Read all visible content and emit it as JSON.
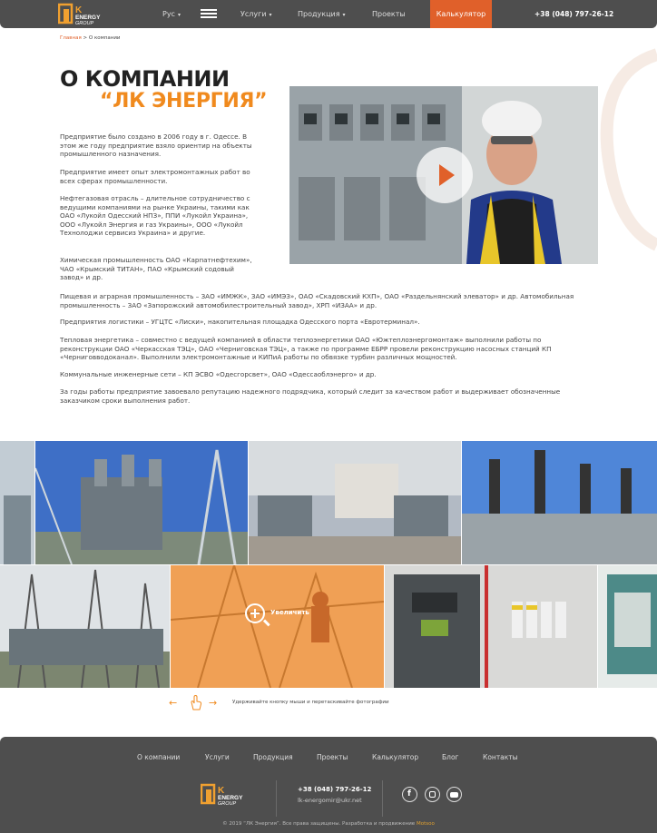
{
  "header": {
    "logo_text": "ЛК ENERGY GROUP",
    "lang": "Рус",
    "nav": [
      "Услуги",
      "Продукция",
      "Проекты"
    ],
    "calc": "Калькулятор",
    "phone": "+38 (048) 797-26-12"
  },
  "breadcrumb": {
    "home": "Главная",
    "sep": ">",
    "current": "О компании"
  },
  "title": {
    "line1": "О КОМПАНИИ",
    "line2": "“ЛК ЭНЕРГИЯ”"
  },
  "paragraphs": [
    "Предприятие было создано в 2006 году в г. Одессе. В этом же году предприятие взяло ориентир на объекты промышленного назначения.",
    "Предприятие имеет опыт электромонтажных работ во всех сферах промышленности.",
    "Нефтегазовая отрасль – длительное сотрудничество с ведущими компаниями на рынке Украины, такими как ОАО «Лукойл Одесский НПЗ», ППИ «Лукойл Украина», ООО «Лукойл Энергия и газ Украины», ООО «Лукойл Технолоджи сервисиз Украина» и другие.",
    "Химическая промышленность ОАО «Карпатнефтехим», ЧАО «Крымский ТИТАН», ПАО «Крымский содовый завод» и др.",
    "Пищевая и аграрная промышленность – ЗАО «ИМЖК», ЗАО «ИМЭЗ», ОАО «Скадовский КХП», ОАО «Раздельнянский элеватор» и др. Автомобильная промышленность – ЗАО «Запорожский автомобилестроительный завод», ХРП «ИЗАА» и др.",
    "Предприятия логистики – УГЦТС «Лиски», накопительная площадка Одесского порта «Евротерминал».",
    "Тепловая энергетика – совместно с ведущей компанией в области теплоэнергетики ОАО «Южтеплоэнергомонтаж» выполнили работы по реконструкции ОАО «Черкасская ТЭЦ», ОАО «Черниговская ТЭЦ», а также по программе ЕБРР провели реконструкцию насосных станций КП «Черниговводоканал». Выполнили электромонтажные и КИПиА работы по обвязке турбин различных мощностей.",
    "Коммунальные инженерные сети – КП ЭСВО «Одесгорсвет», ОАО «Одессаоблэнерго» и др.",
    "За годы работы предприятие завоевало репутацию надежного подрядчика, который следит за качеством работ и выдерживает обозначенные заказчиком сроки выполнения работ."
  ],
  "gallery": {
    "zoom_label": "Увеличить",
    "hint": "Удерживайте кнопку мыши и перетаскивайте фотографии"
  },
  "footer": {
    "nav": [
      "О компании",
      "Услуги",
      "Продукция",
      "Проекты",
      "Калькулятор",
      "Блог",
      "Контакты"
    ],
    "phone": "+38 (048) 797-26-12",
    "email": "lk-energomir@ukr.net",
    "copyright": "© 2019 “ЛК Энергия”. Все права защищены. Разработка и продвижение",
    "developer": "Motsoo"
  },
  "colors": {
    "accent": "#e0602a",
    "orange": "#f08a1e",
    "dark": "#4e4e4e"
  }
}
